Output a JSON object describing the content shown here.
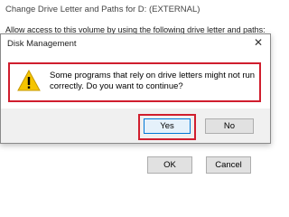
{
  "background_window": {
    "title": "Change Drive Letter and Paths for D: (EXTERNAL)",
    "description": "Allow access to this volume by using the following drive letter and paths:",
    "ok_label": "OK",
    "cancel_label": "Cancel"
  },
  "dialog": {
    "title": "Disk Management",
    "close_glyph": "✕",
    "message": "Some programs that rely on drive letters might not run correctly. Do you want to continue?",
    "icon": "warning-icon",
    "yes_label": "Yes",
    "no_label": "No"
  },
  "colors": {
    "highlight": "#d01e2e",
    "warning_fill": "#f5c400"
  }
}
